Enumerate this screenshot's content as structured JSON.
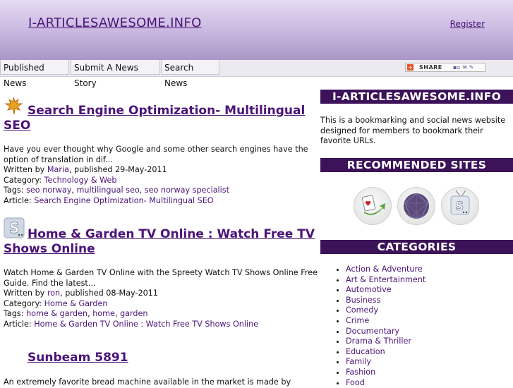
{
  "header": {
    "site_title": "I-ARTICLESAWESOME.INFO",
    "register_label": "Register"
  },
  "nav": {
    "items": [
      {
        "label": "Published News"
      },
      {
        "label": "Submit A News Story"
      },
      {
        "label": "Search News"
      }
    ],
    "share_label": "SHARE",
    "share_services": "▪▫ ✉ ✎"
  },
  "stories": [
    {
      "icon": "maple-leaf-icon",
      "title": "Search Engine Optimization- Multilingual SEO",
      "summary": "Have you ever thought why Google and some other search engines have the option of translation in dif...",
      "written_by_prefix": "Written by ",
      "author": "Maria",
      "published": ", published 29-May-2011",
      "category_prefix": "Category: ",
      "category": "Technology & Web",
      "tags_prefix": "Tags: ",
      "tags": [
        "seo norway",
        "multilingual seo",
        "seo norway specialist"
      ],
      "article_prefix": "Article: ",
      "article": "Search Engine Optimization- Multilingual SEO"
    },
    {
      "icon": "spreety-logo-icon",
      "title": "Home & Garden TV Online : Watch Free TV Shows Online",
      "summary": "Watch Home & Garden TV Online with the Spreety Watch TV Shows Online Free Guide. Find the latest...",
      "written_by_prefix": "Written by ",
      "author": "ron",
      "published": ", published 08-May-2011",
      "category_prefix": "Category: ",
      "category": "Home & Garden",
      "tags_prefix": "Tags: ",
      "tags": [
        "home & garden",
        "home",
        "garden"
      ],
      "article_prefix": "Article: ",
      "article": "Home & Garden TV Online : Watch Free TV Shows Online"
    },
    {
      "title": "Sunbeam 5891",
      "summary": "An extremely favorite bread machine available in the market is made by"
    }
  ],
  "sidebar": {
    "about_heading": "I-ARTICLESAWESOME.INFO",
    "about_text": "This is a bookmarking and social news website designed for members to bookmark their favorite URLs.",
    "recommended_heading": "RECOMMENDED SITES",
    "recommended": [
      {
        "icon": "cards-arrow-icon"
      },
      {
        "icon": "purple-sphere-icon"
      },
      {
        "icon": "tv-spreety-icon"
      }
    ],
    "categories_heading": "CATEGORIES",
    "categories": [
      "Action & Adventure",
      "Art & Entertainment",
      "Automotive",
      "Business",
      "Comedy",
      "Crime",
      "Documentary",
      "Drama & Thriller",
      "Education",
      "Family",
      "Fashion",
      "Food"
    ]
  }
}
